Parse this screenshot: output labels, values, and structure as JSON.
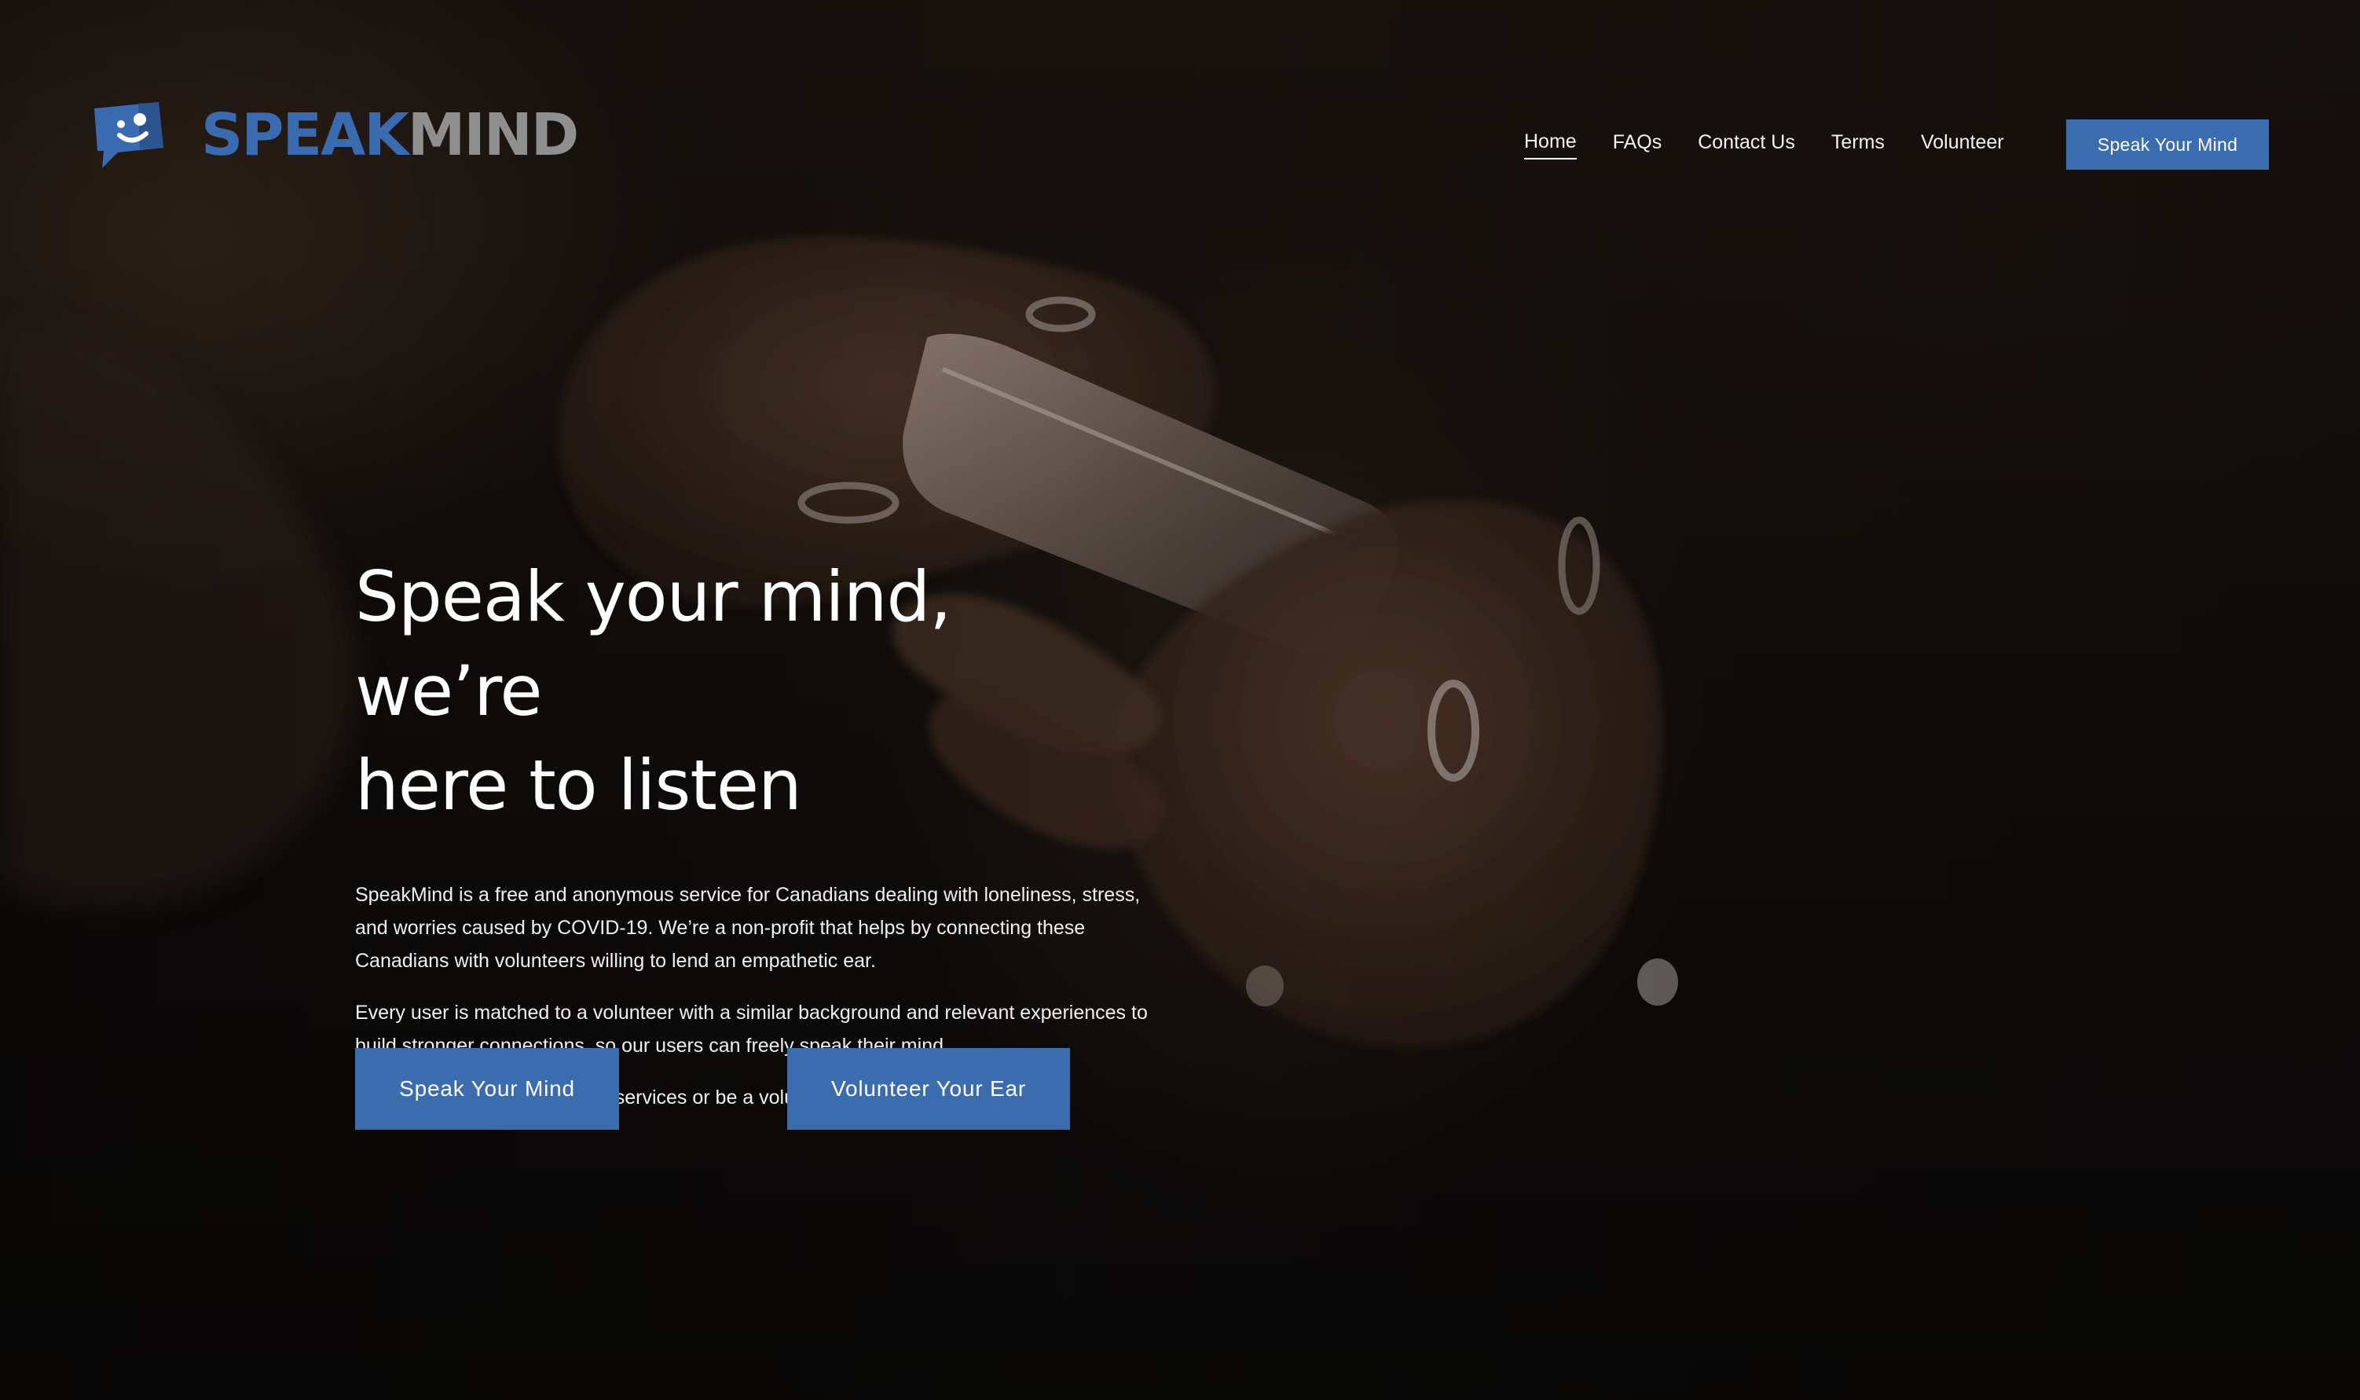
{
  "brand": {
    "logo_speak": "SPEAK",
    "logo_mind": "MIND",
    "logo_icon": "chat-bubble-face-icon",
    "colors": {
      "primary": "#3a6cae",
      "logo_gray": "#8f8f8f"
    }
  },
  "nav": {
    "items": [
      {
        "label": "Home",
        "active": true
      },
      {
        "label": "FAQs"
      },
      {
        "label": "Contact Us"
      },
      {
        "label": "Terms"
      },
      {
        "label": "Volunteer"
      }
    ],
    "cta_label": "Speak Your Mind"
  },
  "hero": {
    "headline_line1": "Speak your mind, we’re",
    "headline_line2": "here to listen",
    "paragraphs": [
      "SpeakMind is a free and anonymous service for Canadians dealing with loneliness, stress, and worries caused by COVID-19. We’re a non-profit that helps by connecting these Canadians with volunteers willing to lend an empathetic ear.",
      "Every user is matched to a volunteer with a similar background and relevant experiences to build stronger connections, so our users can freely speak their mind.",
      "If you’re interested to use our services or be a volunteer, sign up below:"
    ],
    "primary_cta": "Speak Your Mind",
    "secondary_cta": "Volunteer Your Ear"
  }
}
